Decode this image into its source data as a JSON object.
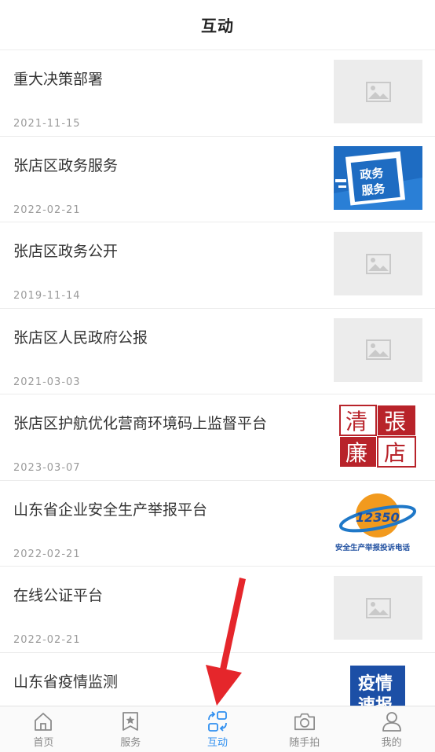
{
  "header": {
    "title": "互动"
  },
  "items": [
    {
      "title": "重大决策部署",
      "date": "2021-11-15",
      "thumb": "placeholder"
    },
    {
      "title": "张店区政务服务",
      "date": "2022-02-21",
      "thumb": "zwfw",
      "thumb_text": [
        "政务",
        "服务"
      ]
    },
    {
      "title": "张店区政务公开",
      "date": "2019-11-14",
      "thumb": "placeholder"
    },
    {
      "title": "张店区人民政府公报",
      "date": "2021-03-03",
      "thumb": "placeholder"
    },
    {
      "title": "张店区护航优化营商环境码上监督平台",
      "date": "2023-03-07",
      "thumb": "seal",
      "thumb_text": [
        "清",
        "張",
        "廉",
        "店"
      ]
    },
    {
      "title": "山东省企业安全生产举报平台",
      "date": "2022-02-21",
      "thumb": "12350",
      "thumb_text": [
        "12350",
        "安全生产举报投诉电话"
      ]
    },
    {
      "title": "在线公证平台",
      "date": "2022-02-21",
      "thumb": "placeholder"
    },
    {
      "title": "山东省疫情监测",
      "date": "",
      "thumb": "yqsb",
      "thumb_text": [
        "疫情",
        "速报"
      ]
    }
  ],
  "tabbar": {
    "tabs": [
      {
        "label": "首页",
        "icon": "home-icon"
      },
      {
        "label": "服务",
        "icon": "bookmark-star-icon"
      },
      {
        "label": "互动",
        "icon": "interact-icon",
        "active": true
      },
      {
        "label": "随手拍",
        "icon": "camera-icon"
      },
      {
        "label": "我的",
        "icon": "user-icon"
      }
    ]
  },
  "colors": {
    "accent": "#2f8ff0",
    "arrow": "#e5262b",
    "placeholder_bg": "#ececec"
  }
}
